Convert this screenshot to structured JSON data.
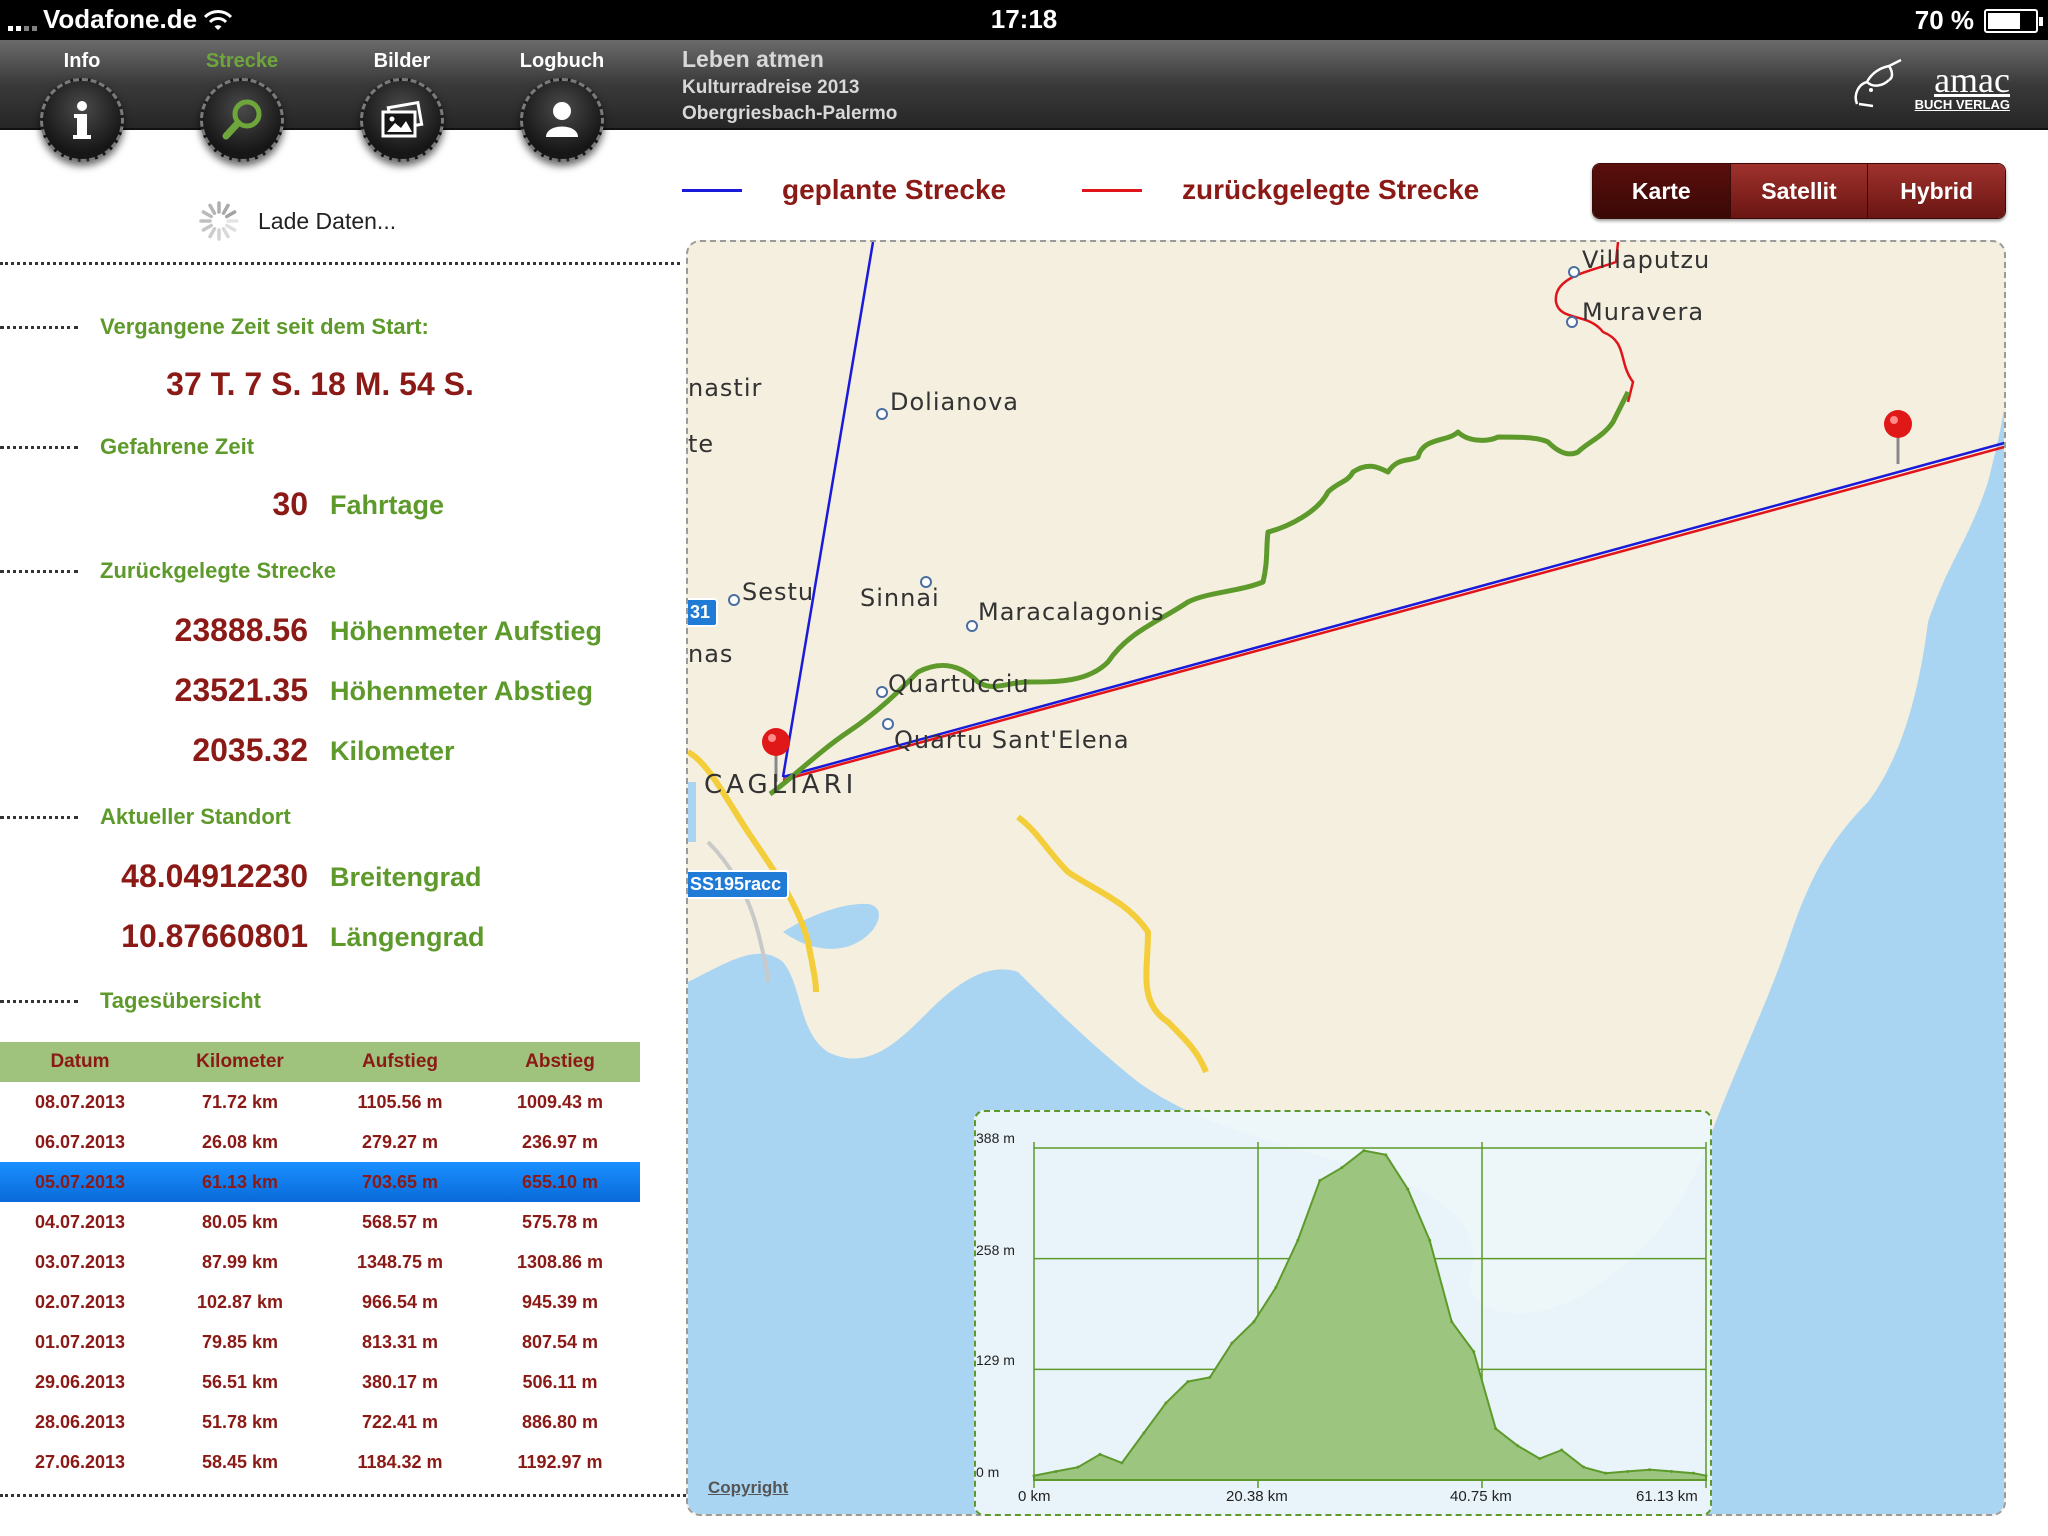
{
  "status_bar": {
    "carrier": "Vodafone.de",
    "time": "17:18",
    "battery": "70 %",
    "battery_level": 0.7
  },
  "nav": {
    "tabs": [
      {
        "label": "Info",
        "icon": "info-icon"
      },
      {
        "label": "Strecke",
        "icon": "magnifier-icon",
        "active": true
      },
      {
        "label": "Bilder",
        "icon": "pictures-icon"
      },
      {
        "label": "Logbuch",
        "icon": "person-icon"
      }
    ],
    "title": "Leben atmen",
    "subtitle1": "Kulturradreise 2013",
    "subtitle2": "Obergriesbach-Palermo",
    "logo_text": "amac",
    "logo_sub": "BUCH VERLAG",
    "logo_reg": "®"
  },
  "left": {
    "loading_text": "Lade Daten...",
    "elapsed_label": "Vergangene Zeit seit dem Start:",
    "elapsed_value": "37 T. 7 S. 18 M. 54 S.",
    "driven_label": "Gefahrene Zeit",
    "driven_value": "30",
    "driven_unit": "Fahrtage",
    "distance_label": "Zurückgelegte Strecke",
    "ascent_value": "23888.56",
    "ascent_unit": "Höhenmeter Aufstieg",
    "descent_value": "23521.35",
    "descent_unit": "Höhenmeter Abstieg",
    "km_value": "2035.32",
    "km_unit": "Kilometer",
    "location_label": "Aktueller Standort",
    "lat_value": "48.04912230",
    "lat_unit": "Breitengrad",
    "lon_value": "10.87660801",
    "lon_unit": "Längengrad",
    "overview_label": "Tagesübersicht"
  },
  "table": {
    "headers": [
      "Datum",
      "Kilometer",
      "Aufstieg",
      "Abstieg"
    ],
    "rows": [
      [
        "08.07.2013",
        "71.72 km",
        "1105.56 m",
        "1009.43 m"
      ],
      [
        "06.07.2013",
        "26.08 km",
        "279.27 m",
        "236.97 m"
      ],
      [
        "05.07.2013",
        "61.13 km",
        "703.65 m",
        "655.10 m"
      ],
      [
        "04.07.2013",
        "80.05 km",
        "568.57 m",
        "575.78 m"
      ],
      [
        "03.07.2013",
        "87.99 km",
        "1348.75 m",
        "1308.86 m"
      ],
      [
        "02.07.2013",
        "102.87 km",
        "966.54 m",
        "945.39 m"
      ],
      [
        "01.07.2013",
        "79.85 km",
        "813.31 m",
        "807.54 m"
      ],
      [
        "29.06.2013",
        "56.51 km",
        "380.17 m",
        "506.11 m"
      ],
      [
        "28.06.2013",
        "51.78 km",
        "722.41 m",
        "886.80 m"
      ],
      [
        "27.06.2013",
        "58.45 km",
        "1184.32 m",
        "1192.97 m"
      ]
    ],
    "selected_index": 2
  },
  "legend": {
    "planned_label": "geplante Strecke",
    "planned_color": "#1a1adb",
    "traveled_label": "zurückgelegte Strecke",
    "traveled_color": "#e0141a"
  },
  "map_type": {
    "options": [
      "Karte",
      "Satellit",
      "Hybrid"
    ],
    "active": "Karte"
  },
  "map": {
    "places": [
      "Villaputzu",
      "Muravera",
      "nastir",
      "te",
      "Dolianova",
      "Sestu",
      "Sinnai",
      "Maracalagonis",
      "nas",
      "Quartucciu",
      "Quartu Sant'Elena",
      "CAGLIARI"
    ],
    "road_shields": [
      "31",
      "SS195racc"
    ],
    "copyright": "Copyright",
    "colors": {
      "land": "#f4efdf",
      "water": "#a9d5f3",
      "track": "#5e9a2b",
      "road": "#f3cd3a"
    }
  },
  "elevation": {
    "y_ticks": [
      "388 m",
      "258 m",
      "129 m",
      "0 m"
    ],
    "x_ticks": [
      "0 km",
      "20.38 km",
      "40.75 km",
      "61.13 km"
    ],
    "fill_color": "#9cc67f",
    "line_color": "#5e9a2b"
  },
  "chart_data": {
    "type": "area",
    "xlabel": "",
    "ylabel": "",
    "xlim": [
      0,
      61.13
    ],
    "ylim": [
      0,
      388
    ],
    "x": [
      0,
      2,
      4,
      6,
      8,
      10,
      12,
      14,
      16,
      18,
      20,
      22,
      24,
      26,
      28,
      30,
      32,
      34,
      36,
      38,
      40,
      42,
      44,
      46,
      48,
      50,
      52,
      54,
      56,
      58,
      60,
      61.13
    ],
    "series": [
      {
        "values": [
          5,
          10,
          15,
          30,
          20,
          55,
          90,
          115,
          120,
          160,
          185,
          225,
          280,
          350,
          365,
          385,
          380,
          340,
          280,
          185,
          150,
          60,
          40,
          25,
          35,
          15,
          8,
          10,
          12,
          10,
          8,
          5
        ]
      }
    ]
  }
}
